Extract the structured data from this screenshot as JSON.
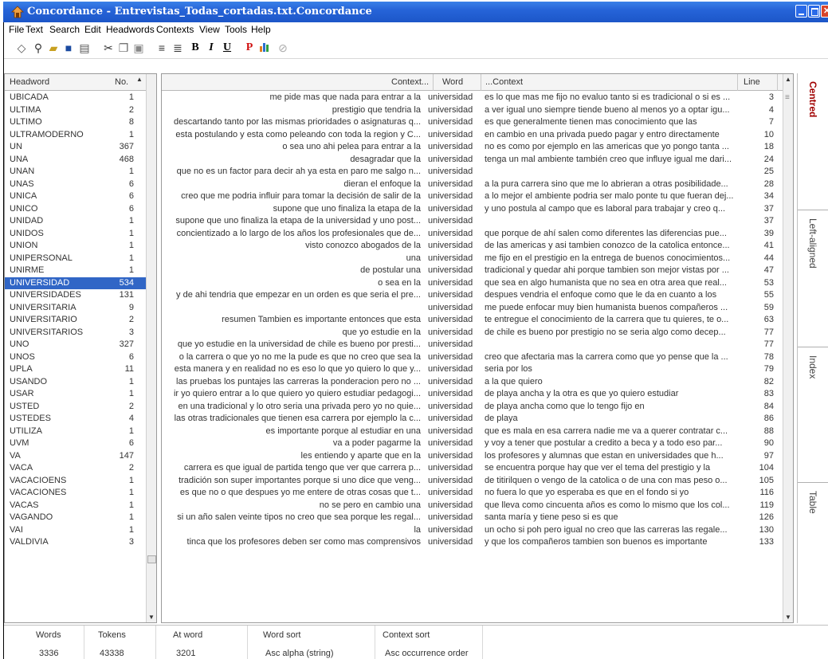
{
  "window": {
    "title": "Concordance - Entrevistas_Todas_cortadas.txt.Concordance"
  },
  "menu": [
    "File",
    "Text",
    "Search",
    "Edit",
    "Headwords",
    "Contexts",
    "View",
    "Tools",
    "Help"
  ],
  "toolbar": {
    "icons": [
      "eraser-icon",
      "binoculars-icon",
      "open-folder-icon",
      "save-icon",
      "print-icon",
      "cut-icon",
      "copy-icon",
      "paste-icon",
      "align-left-icon",
      "align-center-icon",
      "bold-icon",
      "italic-icon",
      "underline-icon",
      "p-icon",
      "chart-icon",
      "help-icon"
    ],
    "bold": "B",
    "italic": "I",
    "underline": "U",
    "p": "P"
  },
  "headwords": {
    "col_word": "Headword",
    "col_no": "No.",
    "selected": "UNIVERSIDAD",
    "rows": [
      [
        "UBICADA",
        "1"
      ],
      [
        "ULTIMA",
        "2"
      ],
      [
        "ULTIMO",
        "8"
      ],
      [
        "ULTRAMODERNO",
        "1"
      ],
      [
        "UN",
        "367"
      ],
      [
        "UNA",
        "468"
      ],
      [
        "UNAN",
        "1"
      ],
      [
        "UNAS",
        "6"
      ],
      [
        "UNICA",
        "6"
      ],
      [
        "UNICO",
        "6"
      ],
      [
        "UNIDAD",
        "1"
      ],
      [
        "UNIDOS",
        "1"
      ],
      [
        "UNION",
        "1"
      ],
      [
        "UNIPERSONAL",
        "1"
      ],
      [
        "UNIRME",
        "1"
      ],
      [
        "UNIVERSIDAD",
        "534"
      ],
      [
        "UNIVERSIDADES",
        "131"
      ],
      [
        "UNIVERSITARIA",
        "9"
      ],
      [
        "UNIVERSITARIO",
        "2"
      ],
      [
        "UNIVERSITARIOS",
        "3"
      ],
      [
        "UNO",
        "327"
      ],
      [
        "UNOS",
        "6"
      ],
      [
        "UPLA",
        "11"
      ],
      [
        "USANDO",
        "1"
      ],
      [
        "USAR",
        "1"
      ],
      [
        "USTED",
        "2"
      ],
      [
        "USTEDES",
        "4"
      ],
      [
        "UTILIZA",
        "1"
      ],
      [
        "UVM",
        "6"
      ],
      [
        "VA",
        "147"
      ],
      [
        "VACA",
        "2"
      ],
      [
        "VACACIOENS",
        "1"
      ],
      [
        "VACACIONES",
        "1"
      ],
      [
        "VACAS",
        "1"
      ],
      [
        "VAGANDO",
        "1"
      ],
      [
        "VAI",
        "1"
      ],
      [
        "VALDIVIA",
        "3"
      ]
    ]
  },
  "concordance": {
    "col_context_left": "Context...",
    "col_word": "Word",
    "col_context_right": "...Context",
    "col_line": "Line",
    "rows": [
      [
        "me pide mas que nada para entrar a la",
        "universidad",
        "es lo que mas me fijo no evaluo tanto si es tradicional o si es ...",
        "3"
      ],
      [
        "prestigio que tendria la",
        "universidad",
        "a ver igual uno siempre tiende bueno al menos yo a optar igu...",
        "4"
      ],
      [
        "descartando tanto por las mismas prioridades o asignaturas q...",
        "universidad",
        "es que generalmente tienen mas conocimiento que las",
        "7"
      ],
      [
        "esta postulando y esta como peleando con toda la region y C...",
        "universidad",
        "en cambio en una privada puedo pagar y entro directamente",
        "10"
      ],
      [
        "o sea uno ahi pelea para entrar a la",
        "universidad",
        "no es como por ejemplo en las americas que yo pongo tanta ...",
        "18"
      ],
      [
        "desagradar que la",
        "universidad",
        "tenga un mal ambiente también creo que influye igual me dari...",
        "24"
      ],
      [
        "que no es un factor para decir ah ya esta en paro me salgo n...",
        "universidad",
        "",
        "25"
      ],
      [
        "dieran el enfoque la",
        "universidad",
        "a la pura carrera sino que me lo abrieran a otras posibilidade...",
        "28"
      ],
      [
        "creo que me podria influir para tomar la decisión de salir de la",
        "universidad",
        "a lo mejor el ambiente podria ser malo ponte tu que fueran dej...",
        "34"
      ],
      [
        "supone que uno finaliza la etapa de la",
        "universidad",
        "y uno postula al campo que es laboral para trabajar y creo q...",
        "37"
      ],
      [
        "supone que uno finaliza la etapa de la universidad y uno post...",
        "universidad",
        "",
        "37"
      ],
      [
        "concientizado a lo largo de los años los profesionales que de...",
        "universidad",
        "que porque de ahí salen como diferentes las diferencias pue...",
        "39"
      ],
      [
        "visto conozco abogados de la",
        "universidad",
        "de las americas y asi tambien conozco de la catolica entonce...",
        "41"
      ],
      [
        "una",
        "universidad",
        "me fijo en el prestigio en la entrega de buenos conocimientos...",
        "44"
      ],
      [
        "de postular una",
        "universidad",
        "tradicional y quedar ahi porque tambien son mejor vistas por ...",
        "47"
      ],
      [
        "o sea en la",
        "universidad",
        "que sea en algo humanista que no sea en otra area que real...",
        "53"
      ],
      [
        "y de ahi tendria que empezar en un orden es que seria el pre...",
        "universidad",
        "despues vendria el enfoque como que le da en cuanto a los",
        "55"
      ],
      [
        "",
        "universidad",
        "me puede enfocar muy bien humanista buenos compañeros ...",
        "59"
      ],
      [
        "resumen Tambien es importante entonces que esta",
        "universidad",
        "te entregue el conocimiento de la carrera que tu quieres, te o...",
        "63"
      ],
      [
        "que yo estudie en la",
        "universidad",
        "de chile es bueno por prestigio no se seria algo como decep...",
        "77"
      ],
      [
        "que yo estudie en la universidad de chile es bueno por presti...",
        "universidad",
        "",
        "77"
      ],
      [
        "o la carrera o que yo no me la pude es que no creo que sea la",
        "universidad",
        "creo que afectaria mas la carrera como que yo pense que la ...",
        "78"
      ],
      [
        "esta manera y en realidad no es eso lo que yo quiero lo que y...",
        "universidad",
        "seria por los",
        "79"
      ],
      [
        "las pruebas los puntajes las carreras la ponderacion pero no ...",
        "universidad",
        "a la que quiero",
        "82"
      ],
      [
        "ir yo quiero entrar a lo que quiero yo quiero estudiar pedagogi...",
        "universidad",
        "de playa ancha y la otra es que yo quiero estudiar",
        "83"
      ],
      [
        "en una tradicional y lo otro seria una privada pero yo no quie...",
        "universidad",
        "de playa ancha como que lo tengo fijo en",
        "84"
      ],
      [
        "las otras tradicionales que tienen esa carrera por ejemplo la c...",
        "universidad",
        "de playa",
        "86"
      ],
      [
        "es importante porque al estudiar en una",
        "universidad",
        "que es mala en esa carrera nadie me va a querer contratar c...",
        "88"
      ],
      [
        "va a poder pagarme la",
        "universidad",
        "y voy a tener que postular a credito a beca y a todo eso par...",
        "90"
      ],
      [
        "les entiendo y aparte que en la",
        "universidad",
        "los profesores y alumnas que estan en universidades que h...",
        "97"
      ],
      [
        "carrera es que igual de partida tengo que ver que carrera p...",
        "universidad",
        "se encuentra porque hay que ver el tema del prestigio y la",
        "104"
      ],
      [
        "tradición son super importantes porque si uno dice que veng...",
        "universidad",
        "de titirilquen o vengo de la catolica o de una con mas peso o...",
        "105"
      ],
      [
        "es que no o que despues yo me entere de otras cosas que t...",
        "universidad",
        "no fuera lo que yo esperaba es que en el fondo si yo",
        "116"
      ],
      [
        "no se pero en cambio una",
        "universidad",
        "que lleva como cincuenta años es como lo mismo que los col...",
        "119"
      ],
      [
        "si un año salen veinte tipos no creo que sea porque les regal...",
        "universidad",
        "santa maría y tiene peso si es que",
        "126"
      ],
      [
        "la",
        "universidad",
        "un ocho si poh pero igual no creo que las carreras las regale...",
        "130"
      ],
      [
        "tinca que los profesores deben ser como mas comprensivos",
        "universidad",
        "y que los compañeros tambien son buenos es importante",
        "133"
      ]
    ]
  },
  "side_tabs": [
    "Centred",
    "Left-aligned",
    "Index",
    "Table"
  ],
  "status": {
    "labels": [
      "Words",
      "Tokens",
      "At word",
      "Word sort",
      "Context sort"
    ],
    "values": [
      "3336",
      "43338",
      "3201",
      "Asc alpha (string)",
      "Asc occurrence order"
    ]
  }
}
